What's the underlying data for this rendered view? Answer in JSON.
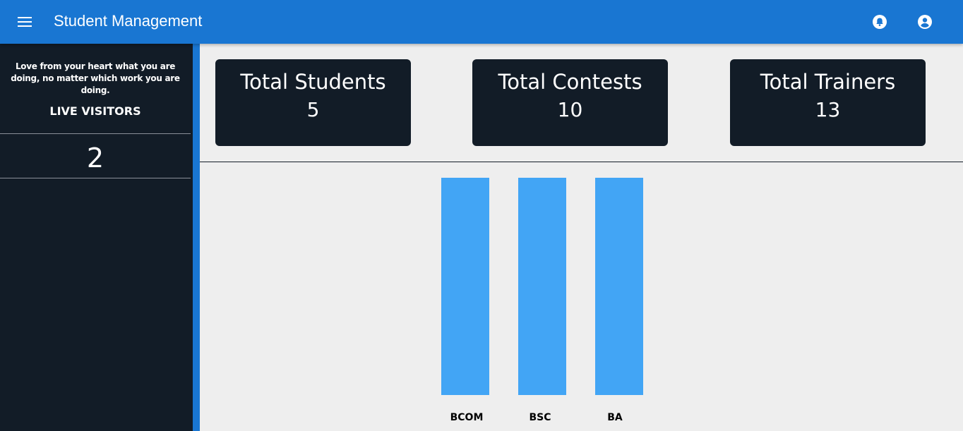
{
  "header": {
    "title": "Student Management",
    "menu_icon": "menu-icon",
    "notification_icon": "bell-icon",
    "account_icon": "account-circle-icon",
    "color": "#1976d2"
  },
  "sidebar": {
    "quote": "Love from your heart what you are doing, no matter which work you are doing.",
    "visitors_title": "LIVE VISITORS",
    "visitors_count": "2"
  },
  "stats": [
    {
      "label": "Total Students",
      "value": "5"
    },
    {
      "label": "Total Contests",
      "value": "10"
    },
    {
      "label": "Total Trainers",
      "value": "13"
    }
  ],
  "chart_data": {
    "type": "bar",
    "categories": [
      "BCOM",
      "BSC",
      "BA"
    ],
    "values": [
      1,
      1,
      1
    ],
    "bar_color": "#42a5f5",
    "title": "",
    "xlabel": "",
    "ylabel": ""
  }
}
